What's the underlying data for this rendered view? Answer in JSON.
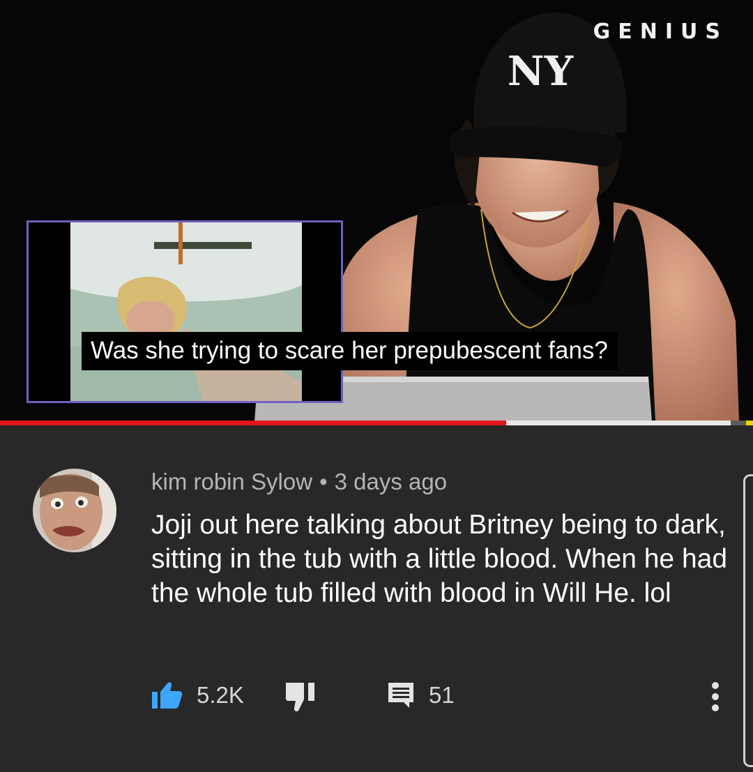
{
  "video": {
    "watermark": "GENIUS",
    "caption": "Was she trying to scare her prepubescent fans?",
    "progress": {
      "played_fraction": 0.672,
      "buffered_fraction": 0.97
    },
    "colors": {
      "played": "#e1171a",
      "buffered": "#e9e9e9",
      "track": "#5b5b5b",
      "pip_border": "#6f62c0"
    }
  },
  "comment": {
    "author": "kim robin Sylow",
    "separator": "•",
    "time": "3 days ago",
    "text": "Joji out here talking about Britney being to dark, sitting in the tub with a little blood. When he had the whole tub filled with blood in Will He. lol",
    "likes": "5.2K",
    "replies": "51",
    "icons": {
      "like": "thumbs-up-icon",
      "dislike": "thumbs-down-icon",
      "reply": "comment-icon",
      "more": "more-vertical-icon"
    },
    "colors": {
      "like_active": "#3ea6ff",
      "text": "#ffffff",
      "meta": "#b5b5b5"
    }
  }
}
